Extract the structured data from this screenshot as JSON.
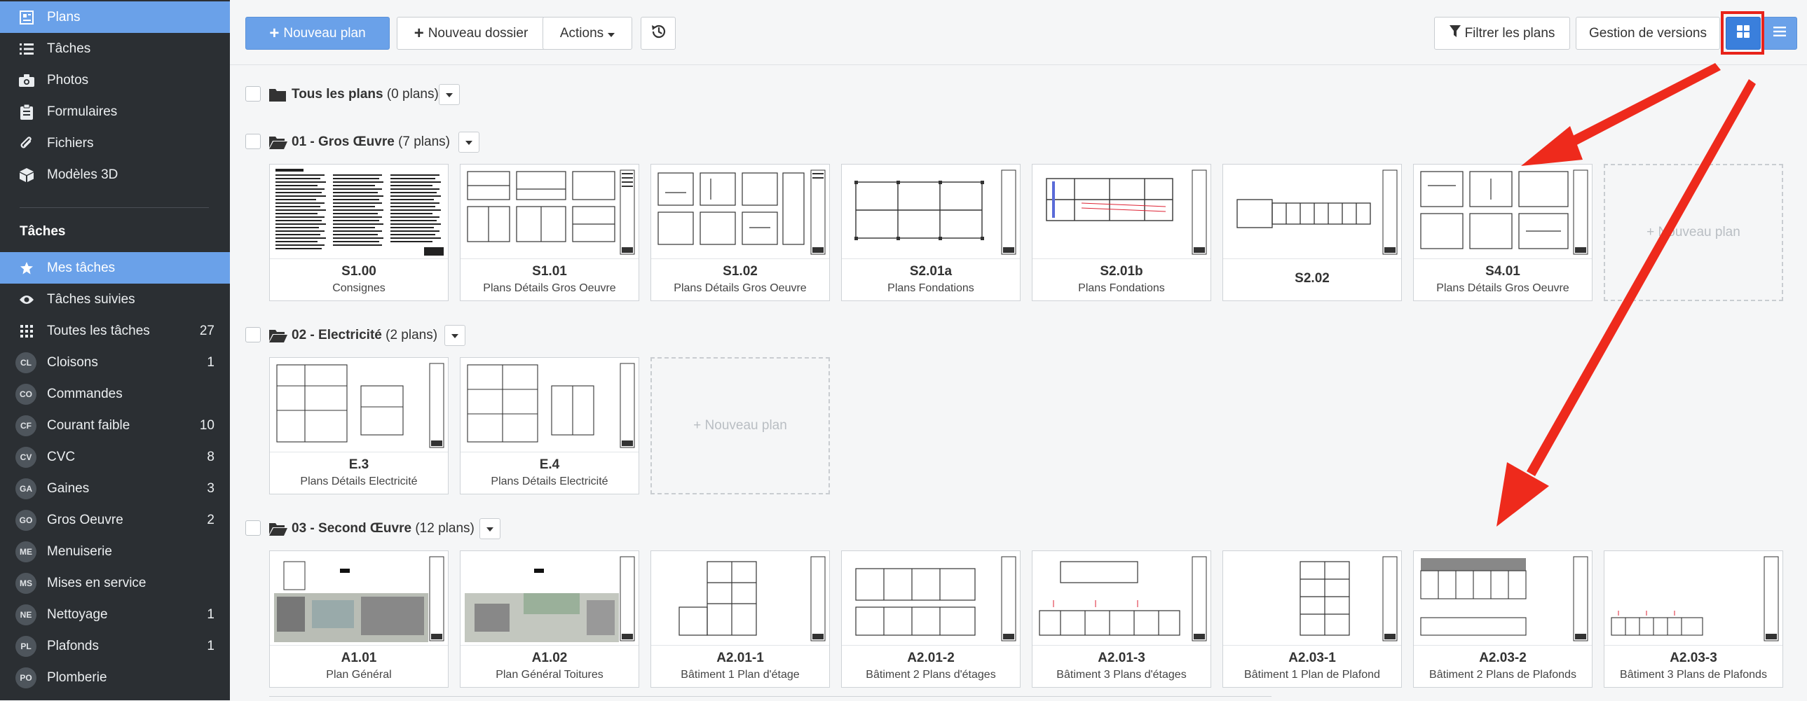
{
  "sidebar": {
    "top_items": [
      {
        "label": "Plans",
        "icon": "plans-icon",
        "active": true
      },
      {
        "label": "Tâches",
        "icon": "list-icon"
      },
      {
        "label": "Photos",
        "icon": "camera-icon"
      },
      {
        "label": "Formulaires",
        "icon": "clipboard-icon"
      },
      {
        "label": "Fichiers",
        "icon": "paperclip-icon"
      },
      {
        "label": "Modèles 3D",
        "icon": "cube-icon"
      }
    ],
    "section_title": "Tâches",
    "task_items": [
      {
        "label": "Mes tâches",
        "icon": "star-icon",
        "count": "",
        "active": true
      },
      {
        "label": "Tâches suivies",
        "icon": "eye-icon",
        "count": ""
      },
      {
        "label": "Toutes les tâches",
        "icon": "grid-icon",
        "count": "27"
      },
      {
        "label": "Cloisons",
        "badge": "CL",
        "count": "1"
      },
      {
        "label": "Commandes",
        "badge": "CO",
        "count": ""
      },
      {
        "label": "Courant faible",
        "badge": "CF",
        "count": "10"
      },
      {
        "label": "CVC",
        "badge": "CV",
        "count": "8"
      },
      {
        "label": "Gaines",
        "badge": "GA",
        "count": "3"
      },
      {
        "label": "Gros Oeuvre",
        "badge": "GO",
        "count": "2"
      },
      {
        "label": "Menuiserie",
        "badge": "ME",
        "count": ""
      },
      {
        "label": "Mises en service",
        "badge": "MS",
        "count": ""
      },
      {
        "label": "Nettoyage",
        "badge": "NE",
        "count": "1"
      },
      {
        "label": "Plafonds",
        "badge": "PL",
        "count": "1"
      },
      {
        "label": "Plomberie",
        "badge": "PO",
        "count": ""
      }
    ]
  },
  "toolbar": {
    "new_plan": "Nouveau plan",
    "new_folder": "Nouveau dossier",
    "actions": "Actions",
    "filter": "Filtrer les plans",
    "versions": "Gestion de versions"
  },
  "all_plans": {
    "name": "Tous les plans",
    "count": "(0 plans)"
  },
  "new_plan_card": "+ Nouveau plan",
  "folders": [
    {
      "name": "01 - Gros Œuvre",
      "count": "(7 plans)",
      "plans": [
        {
          "code": "S1.00",
          "name": "Consignes"
        },
        {
          "code": "S1.01",
          "name": "Plans Détails Gros Oeuvre"
        },
        {
          "code": "S1.02",
          "name": "Plans Détails Gros Oeuvre"
        },
        {
          "code": "S2.01a",
          "name": "Plans Fondations"
        },
        {
          "code": "S2.01b",
          "name": "Plans Fondations"
        },
        {
          "code": "S2.02",
          "name": ""
        },
        {
          "code": "S4.01",
          "name": "Plans Détails Gros Oeuvre"
        }
      ]
    },
    {
      "name": "02 - Electricité",
      "count": "(2 plans)",
      "plans": [
        {
          "code": "E.3",
          "name": "Plans Détails Electricité"
        },
        {
          "code": "E.4",
          "name": "Plans Détails Electricité"
        }
      ]
    },
    {
      "name": "03 - Second Œuvre",
      "count": "(12 plans)",
      "plans": [
        {
          "code": "A1.01",
          "name": "Plan Général"
        },
        {
          "code": "A1.02",
          "name": "Plan Général Toitures"
        },
        {
          "code": "A2.01-1",
          "name": "Bâtiment 1 Plan d'étage"
        },
        {
          "code": "A2.01-2",
          "name": "Bâtiment 2 Plans d'étages"
        },
        {
          "code": "A2.01-3",
          "name": "Bâtiment 3 Plans d'étages"
        },
        {
          "code": "A2.03-1",
          "name": "Bâtiment 1 Plan de Plafond"
        },
        {
          "code": "A2.03-2",
          "name": "Bâtiment 2 Plans de Plafonds"
        },
        {
          "code": "A2.03-3",
          "name": "Bâtiment 3 Plans de Plafonds"
        }
      ]
    }
  ],
  "colors": {
    "accent": "#6aa1e9",
    "sidebar": "#2b2f33",
    "highlight": "#e8231a"
  }
}
